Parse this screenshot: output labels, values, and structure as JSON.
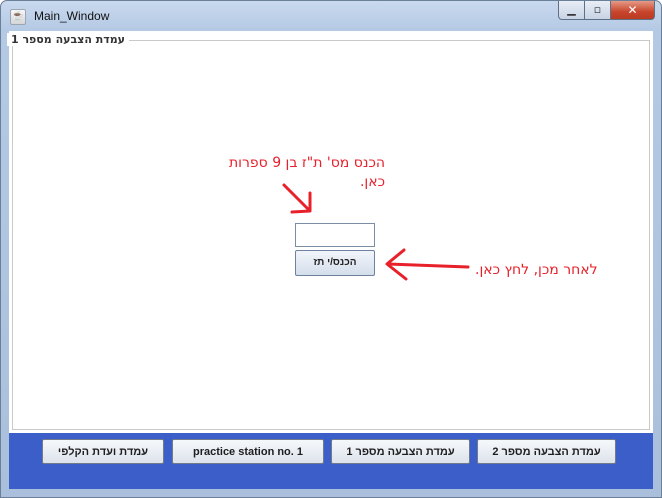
{
  "window": {
    "title": "Main_Window",
    "icon": "java-cup-icon",
    "controls": {
      "minimize": "minimize-icon",
      "maximize": "maximize-icon",
      "close": "close-icon"
    }
  },
  "panel": {
    "legend": "עמדת הצבעה מספר 1"
  },
  "form": {
    "id_input_value": "",
    "enter_button_label": "הכנס/י תז"
  },
  "annotations": {
    "enter_id_line1": "הכנס מס' ת\"ז בן 9 ספרות",
    "enter_id_line2": "כאן.",
    "after_that_click": "לאחר מכן, לחץ כאן.",
    "color": "#e8202a"
  },
  "bottom_bar": {
    "color": "#3c5ec8",
    "buttons": [
      {
        "label": "עמדת ועדת הקלפי"
      },
      {
        "label": "practice station no. 1"
      },
      {
        "label": "עמדת הצבעה מספר 1"
      },
      {
        "label": "עמדת הצבעה מספר 2"
      }
    ]
  }
}
